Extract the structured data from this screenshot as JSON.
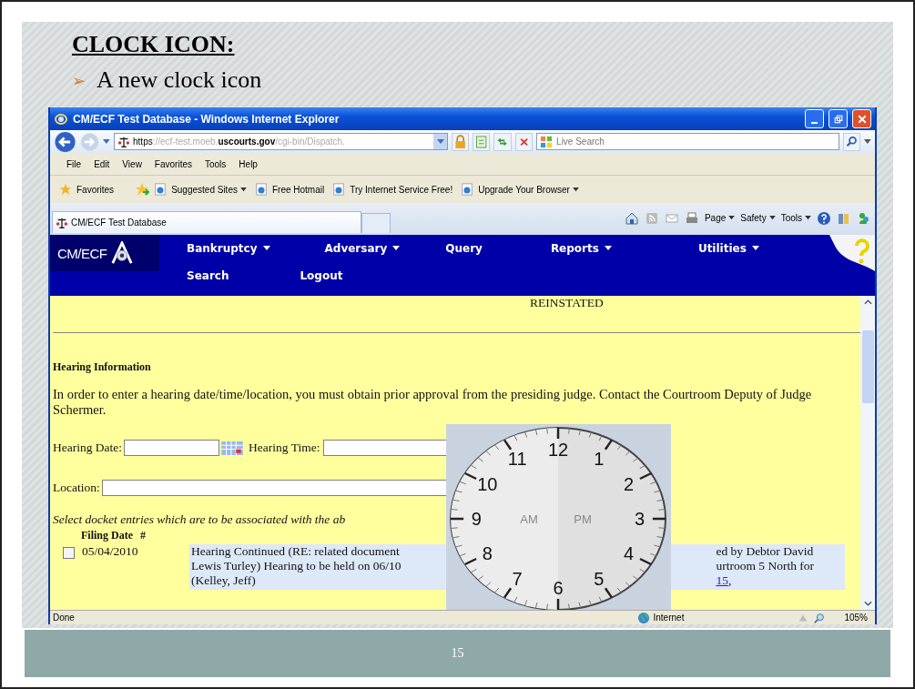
{
  "slide": {
    "title": "CLOCK ICON:",
    "bullet_marker": "➢",
    "bullet": "A new clock icon",
    "page_number": "15"
  },
  "browser": {
    "title": "CM/ECF Test Database - Windows Internet Explorer",
    "address": {
      "scheme": "https",
      "rest": "://ecf-test.moeb.",
      "domain": "uscourts.gov",
      "path": "/cgi-bin/Dispatch."
    },
    "search_placeholder": "Live Search",
    "menu": [
      "File",
      "Edit",
      "View",
      "Favorites",
      "Tools",
      "Help"
    ],
    "favorites_label": "Favorites",
    "favorites_bar": [
      {
        "label": "Suggested Sites",
        "dropdown": true
      },
      {
        "label": "Free Hotmail",
        "dropdown": false
      },
      {
        "label": "Try Internet Service Free!",
        "dropdown": false
      },
      {
        "label": "Upgrade Your Browser",
        "dropdown": true
      }
    ],
    "tab": "CM/ECF Test Database",
    "command_bar": [
      "Page",
      "Safety",
      "Tools"
    ],
    "status": "Done",
    "zone": "Internet",
    "zoom": "105%"
  },
  "app": {
    "logo": "CM/ECF",
    "nav_rows": [
      [
        {
          "label": "Bankruptcy",
          "dropdown": true
        },
        {
          "label": "Adversary",
          "dropdown": true
        },
        {
          "label": "Query",
          "dropdown": false
        },
        {
          "label": "Reports",
          "dropdown": true
        },
        {
          "label": "Utilities",
          "dropdown": true
        }
      ],
      [
        {
          "label": "Search",
          "dropdown": false
        },
        {
          "label": "Logout",
          "dropdown": false
        }
      ]
    ],
    "status_text": "REINSTATED",
    "section_title": "Hearing Information",
    "instructions": "In order to enter a hearing date/time/location, you must obtain prior approval from the presiding judge. Contact the Courtroom Deputy of Judge Schermer.",
    "hearing_date_label": "Hearing Date:",
    "hearing_time_label": "Hearing Time:",
    "location_label": "Location:",
    "select_note": "Select docket entries which are to be associated with the ab",
    "columns": [
      "Filing Date",
      "#"
    ],
    "entries": [
      {
        "checked": false,
        "date": "05/04/2010",
        "text_left": [
          "Hearing Continued (RE: related document",
          "Lewis Turley) Hearing to be held on 06/10",
          "(Kelley, Jeff)"
        ],
        "text_right": [
          "ed by Debtor David",
          "urtroom 5 North for "
        ],
        "link": "15",
        "after_link": ","
      }
    ]
  },
  "clock": {
    "numbers": [
      "12",
      "1",
      "2",
      "3",
      "4",
      "5",
      "6",
      "7",
      "8",
      "9",
      "10",
      "11"
    ],
    "am": "AM",
    "pm": "PM"
  }
}
